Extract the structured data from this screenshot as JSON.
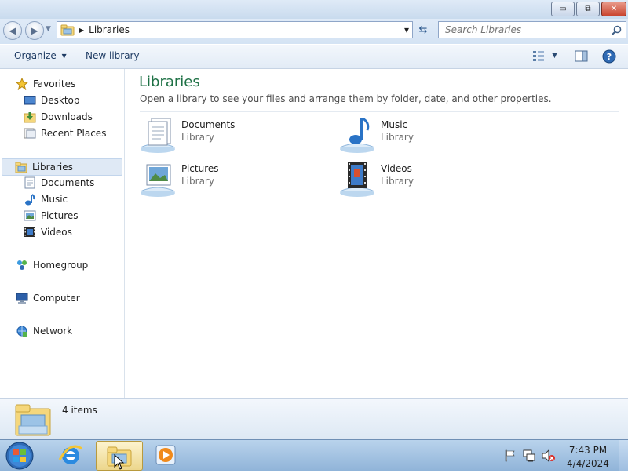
{
  "window": {
    "minimize_glyph": "▭",
    "maximize_glyph": "⧉",
    "close_glyph": "✕"
  },
  "address": {
    "path": "Libraries",
    "dropdown_glyph": "▾",
    "refresh_glyph": "⇆"
  },
  "search": {
    "placeholder": "Search Libraries"
  },
  "toolbar": {
    "organize_label": "Organize",
    "organize_arrow": "▾",
    "new_library_label": "New library"
  },
  "sidebar": {
    "favorites": "Favorites",
    "desktop": "Desktop",
    "downloads": "Downloads",
    "recent_places": "Recent Places",
    "libraries": "Libraries",
    "documents": "Documents",
    "music": "Music",
    "pictures": "Pictures",
    "videos": "Videos",
    "homegroup": "Homegroup",
    "computer": "Computer",
    "network": "Network"
  },
  "main": {
    "title": "Libraries",
    "subtitle": "Open a library to see your files and arrange them by folder, date, and other properties.",
    "items": [
      {
        "name": "Documents",
        "type": "Library"
      },
      {
        "name": "Music",
        "type": "Library"
      },
      {
        "name": "Pictures",
        "type": "Library"
      },
      {
        "name": "Videos",
        "type": "Library"
      }
    ]
  },
  "details": {
    "count": "4 items"
  },
  "taskbar": {
    "time": "7:43 PM",
    "date": "4/4/2024"
  },
  "colors": {
    "title_green": "#1e7145",
    "selection_bg": "#dfe9f5",
    "taskbar": "#a4c3e3"
  }
}
